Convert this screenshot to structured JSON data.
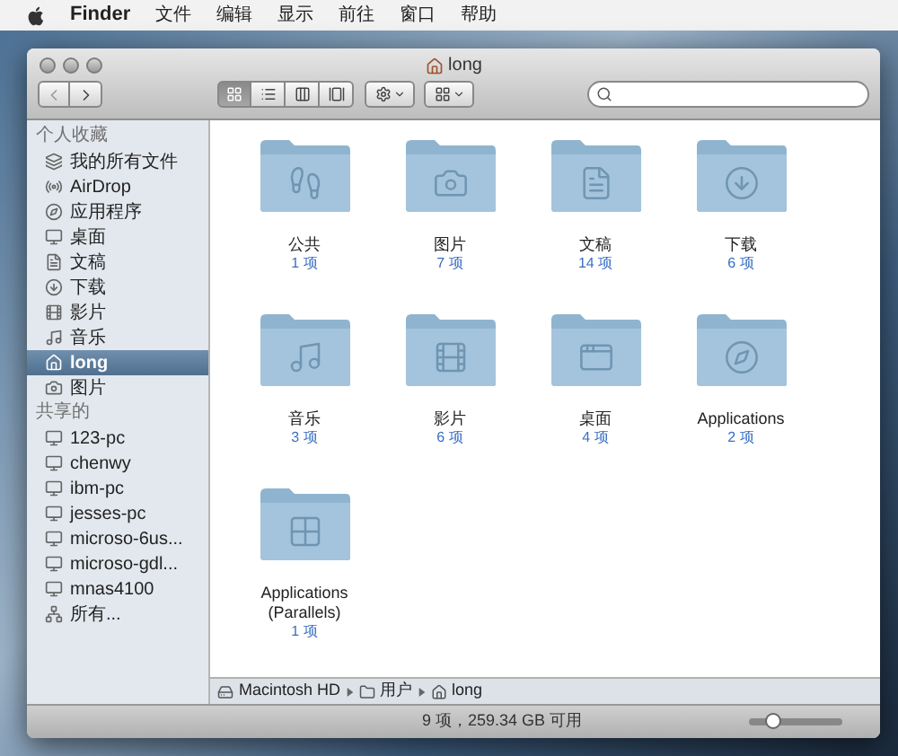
{
  "menu_bar": {
    "app": "Finder",
    "menus": [
      "文件",
      "编辑",
      "显示",
      "前往",
      "窗口",
      "帮助"
    ]
  },
  "window": {
    "title": "long"
  },
  "toolbar": {
    "views": [
      {
        "kind": "icons",
        "selected": true
      },
      {
        "kind": "list",
        "selected": false
      },
      {
        "kind": "columns",
        "selected": false
      },
      {
        "kind": "coverflow",
        "selected": false
      }
    ]
  },
  "sidebar": {
    "sections": [
      {
        "title": "个人收藏",
        "items": [
          {
            "label": "我的所有文件",
            "kind": "all",
            "selected": false
          },
          {
            "label": "AirDrop",
            "kind": "airdrop",
            "selected": false
          },
          {
            "label": "应用程序",
            "kind": "apps",
            "selected": false
          },
          {
            "label": "桌面",
            "kind": "desktop",
            "selected": false
          },
          {
            "label": "文稿",
            "kind": "docs",
            "selected": false
          },
          {
            "label": "下载",
            "kind": "download",
            "selected": false
          },
          {
            "label": "影片",
            "kind": "movies",
            "selected": false
          },
          {
            "label": "音乐",
            "kind": "music",
            "selected": false
          },
          {
            "label": "long",
            "kind": "home",
            "selected": true
          },
          {
            "label": "图片",
            "kind": "pictures",
            "selected": false
          }
        ]
      },
      {
        "title": "共享的",
        "items": [
          {
            "label": "123-pc",
            "kind": "computer",
            "selected": false
          },
          {
            "label": "chenwy",
            "kind": "computer",
            "selected": false
          },
          {
            "label": "ibm-pc",
            "kind": "computer",
            "selected": false
          },
          {
            "label": "jesses-pc",
            "kind": "computer",
            "selected": false
          },
          {
            "label": "microso-6us...",
            "kind": "computer",
            "selected": false
          },
          {
            "label": "microso-gdl...",
            "kind": "computer",
            "selected": false
          },
          {
            "label": "mnas4100",
            "kind": "computer",
            "selected": false
          },
          {
            "label": "所有...",
            "kind": "network",
            "selected": false
          }
        ]
      }
    ]
  },
  "folders": [
    {
      "name": "公共",
      "count": "1 项",
      "kind": "public"
    },
    {
      "name": "图片",
      "count": "7 项",
      "kind": "pictures"
    },
    {
      "name": "文稿",
      "count": "14 项",
      "kind": "docs"
    },
    {
      "name": "下载",
      "count": "6 项",
      "kind": "download"
    },
    {
      "name": "音乐",
      "count": "3 项",
      "kind": "music"
    },
    {
      "name": "影片",
      "count": "6 项",
      "kind": "movies"
    },
    {
      "name": "桌面",
      "count": "4 项",
      "kind": "desktop"
    },
    {
      "name": "Applications",
      "count": "2 项",
      "kind": "apps"
    },
    {
      "name": "Applications (Parallels)",
      "count": "1 项",
      "kind": "windows"
    }
  ],
  "path_bar": [
    {
      "label": "Macintosh HD",
      "kind": "disk"
    },
    {
      "label": "用户",
      "kind": "folder"
    },
    {
      "label": "long",
      "kind": "home"
    }
  ],
  "status_bar": {
    "text": "9 项，259.34 GB 可用",
    "zoom": {
      "level": 0.25
    }
  }
}
